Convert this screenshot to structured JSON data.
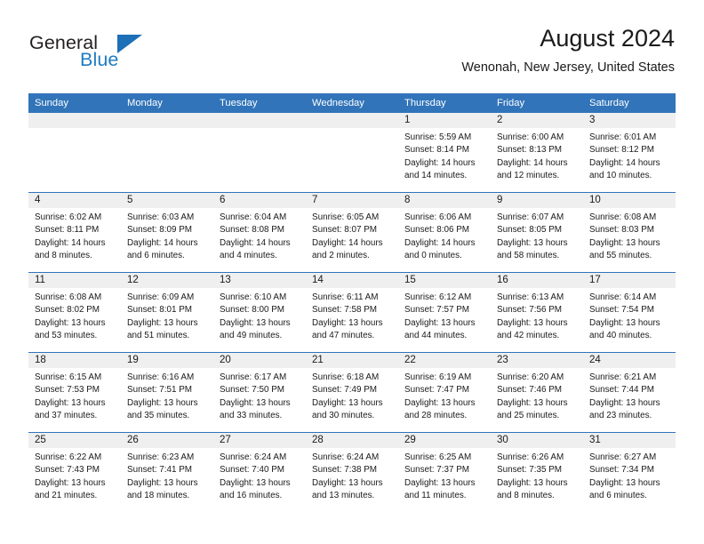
{
  "brand": {
    "word_general": "General",
    "word_blue": "Blue",
    "flag_icon": "triangle-flag-icon"
  },
  "header": {
    "title": "August 2024",
    "subtitle": "Wenonah, New Jersey, United States"
  },
  "colors": {
    "header_blue": "#3174b9",
    "daynum_gray": "#efefef",
    "brand_blue": "#1f7bc1",
    "text": "#1a1a1a"
  },
  "weekday_headers": [
    "Sunday",
    "Monday",
    "Tuesday",
    "Wednesday",
    "Thursday",
    "Friday",
    "Saturday"
  ],
  "weeks": [
    [
      {
        "day": "",
        "sunrise": "",
        "sunset": "",
        "daylight_1": "",
        "daylight_2": ""
      },
      {
        "day": "",
        "sunrise": "",
        "sunset": "",
        "daylight_1": "",
        "daylight_2": ""
      },
      {
        "day": "",
        "sunrise": "",
        "sunset": "",
        "daylight_1": "",
        "daylight_2": ""
      },
      {
        "day": "",
        "sunrise": "",
        "sunset": "",
        "daylight_1": "",
        "daylight_2": ""
      },
      {
        "day": "1",
        "sunrise": "Sunrise: 5:59 AM",
        "sunset": "Sunset: 8:14 PM",
        "daylight_1": "Daylight: 14 hours",
        "daylight_2": "and 14 minutes."
      },
      {
        "day": "2",
        "sunrise": "Sunrise: 6:00 AM",
        "sunset": "Sunset: 8:13 PM",
        "daylight_1": "Daylight: 14 hours",
        "daylight_2": "and 12 minutes."
      },
      {
        "day": "3",
        "sunrise": "Sunrise: 6:01 AM",
        "sunset": "Sunset: 8:12 PM",
        "daylight_1": "Daylight: 14 hours",
        "daylight_2": "and 10 minutes."
      }
    ],
    [
      {
        "day": "4",
        "sunrise": "Sunrise: 6:02 AM",
        "sunset": "Sunset: 8:11 PM",
        "daylight_1": "Daylight: 14 hours",
        "daylight_2": "and 8 minutes."
      },
      {
        "day": "5",
        "sunrise": "Sunrise: 6:03 AM",
        "sunset": "Sunset: 8:09 PM",
        "daylight_1": "Daylight: 14 hours",
        "daylight_2": "and 6 minutes."
      },
      {
        "day": "6",
        "sunrise": "Sunrise: 6:04 AM",
        "sunset": "Sunset: 8:08 PM",
        "daylight_1": "Daylight: 14 hours",
        "daylight_2": "and 4 minutes."
      },
      {
        "day": "7",
        "sunrise": "Sunrise: 6:05 AM",
        "sunset": "Sunset: 8:07 PM",
        "daylight_1": "Daylight: 14 hours",
        "daylight_2": "and 2 minutes."
      },
      {
        "day": "8",
        "sunrise": "Sunrise: 6:06 AM",
        "sunset": "Sunset: 8:06 PM",
        "daylight_1": "Daylight: 14 hours",
        "daylight_2": "and 0 minutes."
      },
      {
        "day": "9",
        "sunrise": "Sunrise: 6:07 AM",
        "sunset": "Sunset: 8:05 PM",
        "daylight_1": "Daylight: 13 hours",
        "daylight_2": "and 58 minutes."
      },
      {
        "day": "10",
        "sunrise": "Sunrise: 6:08 AM",
        "sunset": "Sunset: 8:03 PM",
        "daylight_1": "Daylight: 13 hours",
        "daylight_2": "and 55 minutes."
      }
    ],
    [
      {
        "day": "11",
        "sunrise": "Sunrise: 6:08 AM",
        "sunset": "Sunset: 8:02 PM",
        "daylight_1": "Daylight: 13 hours",
        "daylight_2": "and 53 minutes."
      },
      {
        "day": "12",
        "sunrise": "Sunrise: 6:09 AM",
        "sunset": "Sunset: 8:01 PM",
        "daylight_1": "Daylight: 13 hours",
        "daylight_2": "and 51 minutes."
      },
      {
        "day": "13",
        "sunrise": "Sunrise: 6:10 AM",
        "sunset": "Sunset: 8:00 PM",
        "daylight_1": "Daylight: 13 hours",
        "daylight_2": "and 49 minutes."
      },
      {
        "day": "14",
        "sunrise": "Sunrise: 6:11 AM",
        "sunset": "Sunset: 7:58 PM",
        "daylight_1": "Daylight: 13 hours",
        "daylight_2": "and 47 minutes."
      },
      {
        "day": "15",
        "sunrise": "Sunrise: 6:12 AM",
        "sunset": "Sunset: 7:57 PM",
        "daylight_1": "Daylight: 13 hours",
        "daylight_2": "and 44 minutes."
      },
      {
        "day": "16",
        "sunrise": "Sunrise: 6:13 AM",
        "sunset": "Sunset: 7:56 PM",
        "daylight_1": "Daylight: 13 hours",
        "daylight_2": "and 42 minutes."
      },
      {
        "day": "17",
        "sunrise": "Sunrise: 6:14 AM",
        "sunset": "Sunset: 7:54 PM",
        "daylight_1": "Daylight: 13 hours",
        "daylight_2": "and 40 minutes."
      }
    ],
    [
      {
        "day": "18",
        "sunrise": "Sunrise: 6:15 AM",
        "sunset": "Sunset: 7:53 PM",
        "daylight_1": "Daylight: 13 hours",
        "daylight_2": "and 37 minutes."
      },
      {
        "day": "19",
        "sunrise": "Sunrise: 6:16 AM",
        "sunset": "Sunset: 7:51 PM",
        "daylight_1": "Daylight: 13 hours",
        "daylight_2": "and 35 minutes."
      },
      {
        "day": "20",
        "sunrise": "Sunrise: 6:17 AM",
        "sunset": "Sunset: 7:50 PM",
        "daylight_1": "Daylight: 13 hours",
        "daylight_2": "and 33 minutes."
      },
      {
        "day": "21",
        "sunrise": "Sunrise: 6:18 AM",
        "sunset": "Sunset: 7:49 PM",
        "daylight_1": "Daylight: 13 hours",
        "daylight_2": "and 30 minutes."
      },
      {
        "day": "22",
        "sunrise": "Sunrise: 6:19 AM",
        "sunset": "Sunset: 7:47 PM",
        "daylight_1": "Daylight: 13 hours",
        "daylight_2": "and 28 minutes."
      },
      {
        "day": "23",
        "sunrise": "Sunrise: 6:20 AM",
        "sunset": "Sunset: 7:46 PM",
        "daylight_1": "Daylight: 13 hours",
        "daylight_2": "and 25 minutes."
      },
      {
        "day": "24",
        "sunrise": "Sunrise: 6:21 AM",
        "sunset": "Sunset: 7:44 PM",
        "daylight_1": "Daylight: 13 hours",
        "daylight_2": "and 23 minutes."
      }
    ],
    [
      {
        "day": "25",
        "sunrise": "Sunrise: 6:22 AM",
        "sunset": "Sunset: 7:43 PM",
        "daylight_1": "Daylight: 13 hours",
        "daylight_2": "and 21 minutes."
      },
      {
        "day": "26",
        "sunrise": "Sunrise: 6:23 AM",
        "sunset": "Sunset: 7:41 PM",
        "daylight_1": "Daylight: 13 hours",
        "daylight_2": "and 18 minutes."
      },
      {
        "day": "27",
        "sunrise": "Sunrise: 6:24 AM",
        "sunset": "Sunset: 7:40 PM",
        "daylight_1": "Daylight: 13 hours",
        "daylight_2": "and 16 minutes."
      },
      {
        "day": "28",
        "sunrise": "Sunrise: 6:24 AM",
        "sunset": "Sunset: 7:38 PM",
        "daylight_1": "Daylight: 13 hours",
        "daylight_2": "and 13 minutes."
      },
      {
        "day": "29",
        "sunrise": "Sunrise: 6:25 AM",
        "sunset": "Sunset: 7:37 PM",
        "daylight_1": "Daylight: 13 hours",
        "daylight_2": "and 11 minutes."
      },
      {
        "day": "30",
        "sunrise": "Sunrise: 6:26 AM",
        "sunset": "Sunset: 7:35 PM",
        "daylight_1": "Daylight: 13 hours",
        "daylight_2": "and 8 minutes."
      },
      {
        "day": "31",
        "sunrise": "Sunrise: 6:27 AM",
        "sunset": "Sunset: 7:34 PM",
        "daylight_1": "Daylight: 13 hours",
        "daylight_2": "and 6 minutes."
      }
    ]
  ]
}
